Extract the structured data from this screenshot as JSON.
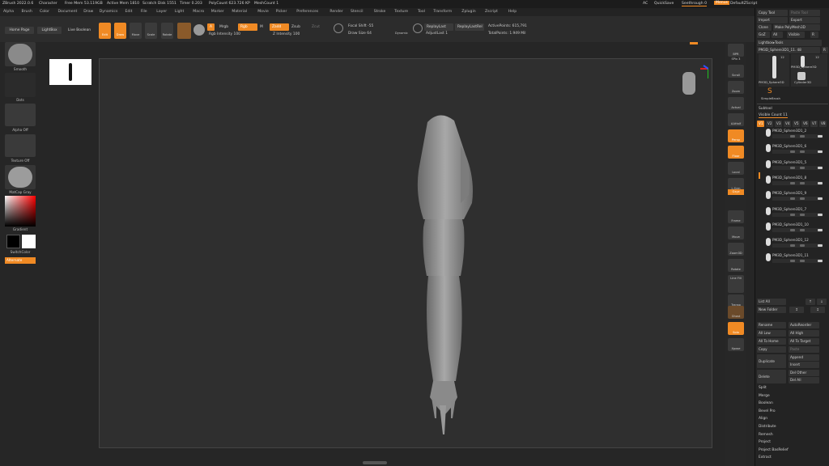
{
  "titlebar": {
    "app": "ZBrush 2022.0.6",
    "doc": "Character",
    "freemem": "Free Mem 53.119GB",
    "activemem": "Active Mem 1810",
    "scratch": "Scratch Disk 1551",
    "timer": "Timer 0.203",
    "polycount": "PolyCount 623.726 KP",
    "meshcount": "MeshCount 1",
    "ac": "AC",
    "quicksave": "QuickSave",
    "seethrough": "Seethrough 0",
    "menus": "Menus",
    "defaultscript": "DefaultZScript"
  },
  "menubar": [
    "Alpha",
    "Brush",
    "Color",
    "Document",
    "Draw",
    "Dynamics",
    "Edit",
    "File",
    "Layer",
    "Light",
    "Macro",
    "Marker",
    "Material",
    "Movie",
    "Picker",
    "Preferences",
    "Render",
    "Stencil",
    "Stroke",
    "Texture",
    "Tool",
    "Transform",
    "Zplugin",
    "Zscript",
    "Help"
  ],
  "shelf": {
    "home": "Home Page",
    "lightbox": "LightBox",
    "liveboolean": "Live Boolean",
    "edit": "Edit",
    "draw": "Draw",
    "move": "Move",
    "scale": "Scale",
    "rotate": "Rotate",
    "a": "A",
    "mrgb": "Mrgb",
    "rgb": "Rgb",
    "m": "M",
    "zadd": "Zadd",
    "zsub": "Zsub",
    "zcut": "Zcut",
    "rgb_intensity": "Rgb Intensity 100",
    "z_intensity": "Z Intensity 100",
    "focal_shift": "Focal Shift -55",
    "draw_size": "Draw Size 64",
    "dynamic": "Dynamic",
    "replaylast": "ReplayLast",
    "replaylastrel": "ReplayLastRel",
    "adjustlast": "AdjustLast 1",
    "activepoints": "ActivePoints: 615,791",
    "totalpoints": "TotalPoints: 1.949 Mil"
  },
  "left": {
    "smooth": "Smooth",
    "dots": "Dots",
    "alpha": "Alpha Off",
    "texture": "Texture Off",
    "matcap": "MatCap Gray",
    "gradient": "Gradient",
    "switchcolor": "SwitchColor",
    "alternate": "Alternate"
  },
  "right": {
    "bpr": "BPR",
    "spix": "SPix 3",
    "scroll": "Scroll",
    "zoom": "Zoom",
    "actual": "Actual",
    "aahalf": "AAHalf",
    "persp": "Persp",
    "floor": "Floor",
    "local": "Local",
    "lsym": "L.Sym",
    "gxyz": "Gxyz",
    "frame": "Frame",
    "move": "Move",
    "zoom3d": "Zoom3D",
    "rotate": "Rotate",
    "linefill": "Line Fill",
    "polyf": "PolyF",
    "transp": "Transp",
    "ghost": "Ghost",
    "solo": "Solo",
    "xpose": "Xpose"
  },
  "tray": {
    "copytool": "Copy Tool",
    "pastetool": "Paste Tool",
    "import": "Import",
    "export": "Export",
    "clone": "Clone",
    "makepolymesh": "Make PolyMesh3D",
    "goz": "GoZ",
    "all": "All",
    "visible": "Visible",
    "r": "R",
    "lightboxtools": "Lightbox▸Tools",
    "current": "PM3D_Sphere3D1_11. 48",
    "r2": "R",
    "thumb1": "PM3D_Sphere3D",
    "thumb2": "PM3D_Sphere3D",
    "thumb3": "Cylinder3D",
    "simplebrush": "SimpleBrush",
    "num12a": "12",
    "num12b": "12",
    "subtool": "Subtool",
    "visiblecount": "Visible Count 11",
    "vtabs": [
      "V1",
      "V2",
      "V3",
      "V4",
      "V5",
      "V6",
      "V7",
      "V8"
    ],
    "subtools": [
      "PM3D_Sphere3D1_2",
      "PM3D_Sphere3D1_6",
      "PM3D_Sphere3D1_5",
      "PM3D_Sphere3D1_8",
      "PM3D_Sphere3D1_9",
      "PM3D_Sphere3D1_7",
      "PM3D_Sphere3D1_10",
      "PM3D_Sphere3D1_12",
      "PM3D_Sphere3D1_11"
    ],
    "listall": "List All",
    "newfolder": "New Folder",
    "rename": "Rename",
    "autoreorder": "AutoReorder",
    "alllow": "All Low",
    "allhigh": "All High",
    "alltohome": "All To Home",
    "alltotarget": "All To Target",
    "copy": "Copy",
    "paste": "Paste",
    "duplicate": "Duplicate",
    "append": "Append",
    "insert": "Insert",
    "delete": "Delete",
    "delother": "Del Other",
    "delall": "Del All",
    "split": "Split",
    "merge": "Merge",
    "boolean": "Boolean",
    "bevelpro": "Bevel Pro",
    "align": "Align",
    "distribute": "Distribute",
    "remesh": "Remesh",
    "project": "Project",
    "projectbasrelief": "Project BasRelief",
    "extract": "Extract"
  }
}
